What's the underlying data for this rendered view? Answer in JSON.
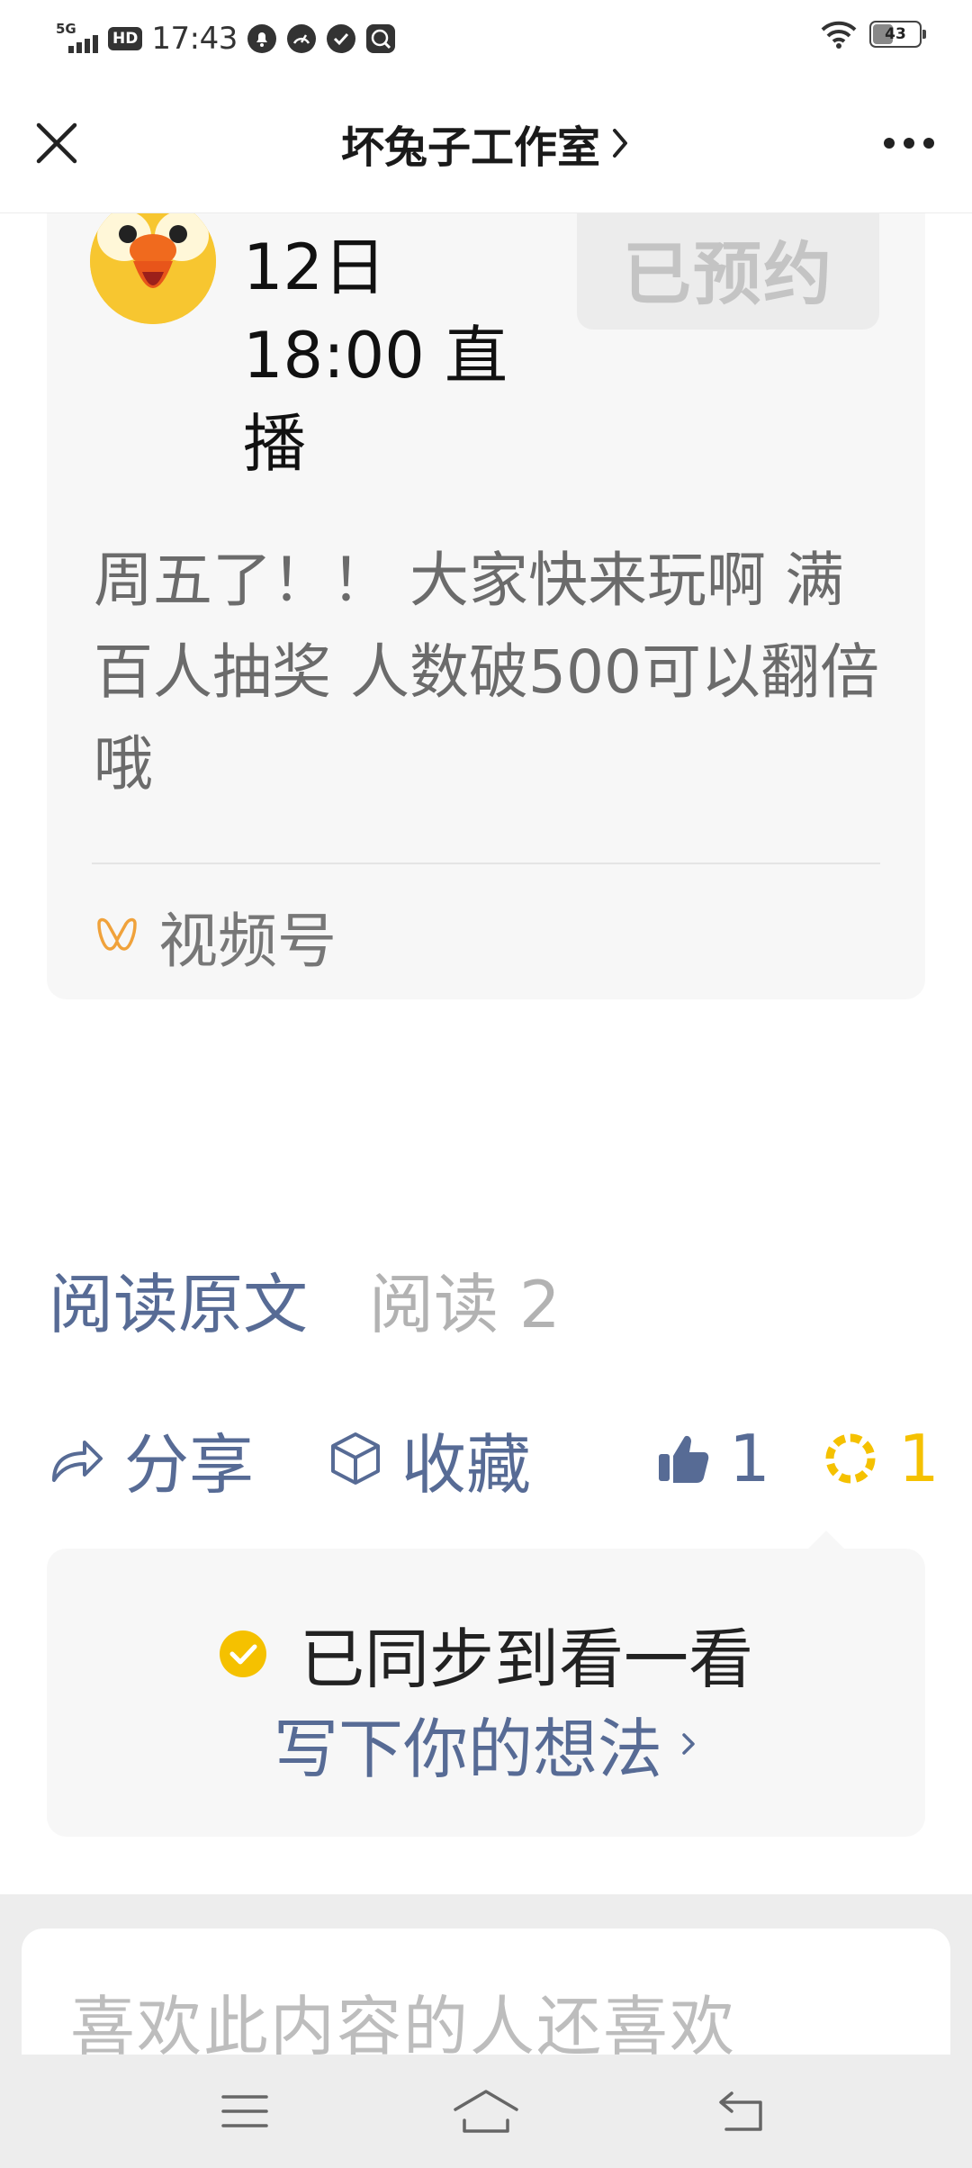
{
  "status_bar": {
    "network": "5G",
    "hd": "HD",
    "time": "17:43",
    "battery": "43"
  },
  "title_bar": {
    "title": "坏兔子工作室"
  },
  "live_card": {
    "time_line1": "12日",
    "time_line2": "18:00 直",
    "time_line3": "播",
    "reserved_label": "已预约",
    "description": "周五了！！ 大家快来玩啊 满百人抽奖 人数破500可以翻倍哦",
    "channel_label": "视频号"
  },
  "read_row": {
    "read_original": "阅读原文",
    "read_count": "阅读 2"
  },
  "actions": {
    "share_label": "分享",
    "favorite_label": "收藏",
    "like_count": "1",
    "wow_count": "1"
  },
  "sync_card": {
    "synced_text": "已同步到看一看",
    "write_prompt": "写下你的想法"
  },
  "related": {
    "title": "喜欢此内容的人还喜欢"
  },
  "colors": {
    "link_blue": "#576b95",
    "gold": "#f5c100",
    "channel_orange": "#f0a23b"
  }
}
